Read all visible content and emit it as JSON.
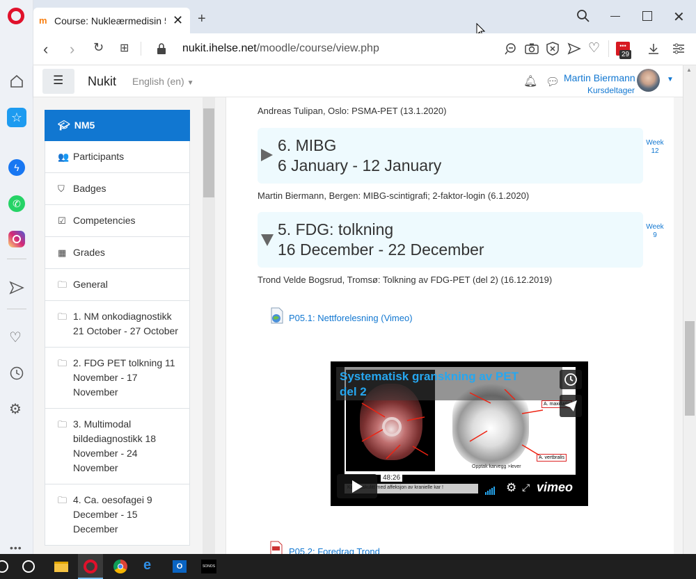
{
  "browser": {
    "tab_title": "Course: Nukleærmedisin 5:",
    "url_host": "nukit.ihelse.net",
    "url_path": "/moodle/course/view.php",
    "badge_count": "29"
  },
  "moodle": {
    "site_name": "Nukit",
    "language": "English (en)",
    "user_name": "Martin Biermann",
    "user_role": "Kursdeltager"
  },
  "drawer": {
    "active": "NM5",
    "items": [
      {
        "icon": "👥",
        "label": "Participants"
      },
      {
        "icon": "⛉",
        "label": "Badges"
      },
      {
        "icon": "☑",
        "label": "Competencies"
      },
      {
        "icon": "▦",
        "label": "Grades"
      },
      {
        "icon": "🗀",
        "label": "General"
      },
      {
        "icon": "🗀",
        "label": "1. NM onkodiagnostikk 21 October - 27 October"
      },
      {
        "icon": "🗀",
        "label": "2. FDG PET tolkning 11 November - 17 November"
      },
      {
        "icon": "🗀",
        "label": "3. Multimodal bildediagnostikk 18 November - 24 November"
      },
      {
        "icon": "🗀",
        "label": "4. Ca. oesofagei 9 December - 15 December"
      }
    ]
  },
  "main": {
    "top_summary": "Andreas Tulipan, Oslo: PSMA-PET (13.1.2020)",
    "sections": [
      {
        "title": "6. MIBG",
        "dates": "6 January - 12 January",
        "week_label": "Week",
        "week_num": "12",
        "summary": "Martin Biermann, Bergen: MIBG-scintigrafi; 2-faktor-login (6.1.2020)"
      },
      {
        "title": "5. FDG: tolkning",
        "dates": "16 December - 22 December",
        "week_label": "Week",
        "week_num": "9",
        "summary": "Trond Velde Bogsrud, Tromsø: Tolkning av FDG-PET (del 2) (16.12.2019)"
      }
    ],
    "link1": "P05.1: Nettforelesning (Vimeo)",
    "link2": "P05.2: Foredrag Trond"
  },
  "video": {
    "title_line1": "Systematisk granskning av PET",
    "title_line2": "del 2",
    "duration": "48:26",
    "brand": "vimeo",
    "label_maxillaris": "A. maxillaris",
    "label_vertbralis": "A. vertbralis",
    "caption_uptake": "Opptak karvegg >lever",
    "caption_bottom": "Karsvaskulitt med affeksjon av kranielle kar !"
  }
}
